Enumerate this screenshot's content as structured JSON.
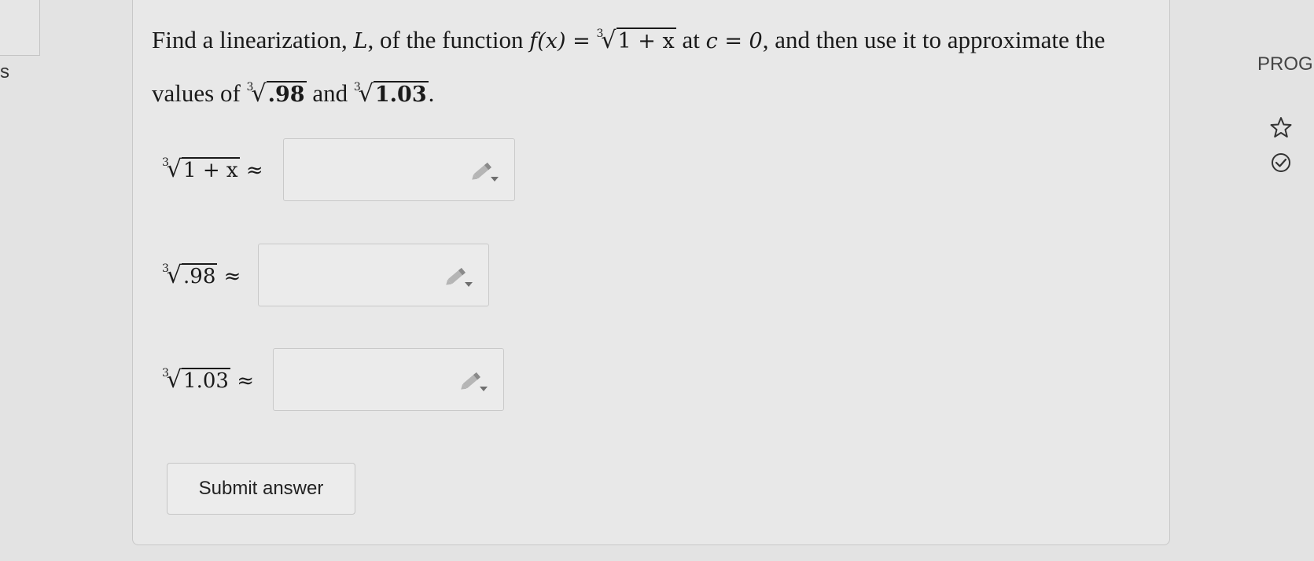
{
  "left_panel": {
    "letter": "s"
  },
  "question": {
    "text_1": "Find a linearization, ",
    "L": "L",
    "text_2": ", of the function ",
    "f_of_x": "f(x) =",
    "root_index": "3",
    "f_radicand": "1 + x",
    "text_at": " at ",
    "c_eq": "c = 0",
    "text_3": ", and then use it to approximate the values of ",
    "val1": ".98",
    "text_and": " and ",
    "val2": "1.03",
    "text_end": "."
  },
  "answers": [
    {
      "root_index": "3",
      "radicand": "1 + x",
      "approx": "≈",
      "placeholder": ""
    },
    {
      "root_index": "3",
      "radicand": ".98",
      "approx": "≈",
      "placeholder": ""
    },
    {
      "root_index": "3",
      "radicand": "1.03",
      "approx": "≈",
      "placeholder": ""
    }
  ],
  "submit_label": "Submit answer",
  "side_panel": {
    "label": "PROG",
    "icons": [
      "star-icon",
      "check-circle-icon"
    ]
  }
}
